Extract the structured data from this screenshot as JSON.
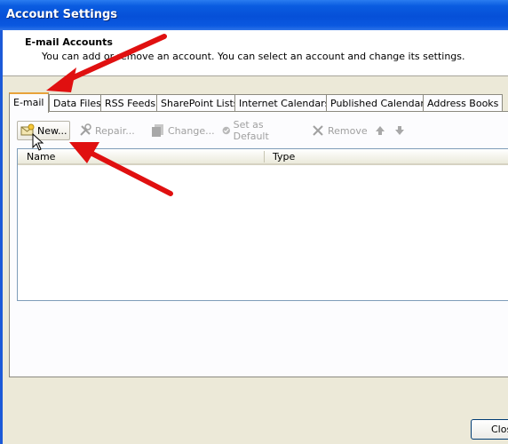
{
  "window": {
    "title": "Account Settings"
  },
  "header": {
    "title": "E-mail Accounts",
    "description": "You can add or remove an account. You can select an account and change its settings."
  },
  "tabs": [
    {
      "label": "E-mail",
      "active": true
    },
    {
      "label": "Data Files"
    },
    {
      "label": "RSS Feeds"
    },
    {
      "label": "SharePoint Lists"
    },
    {
      "label": "Internet Calendars"
    },
    {
      "label": "Published Calendars"
    },
    {
      "label": "Address Books"
    }
  ],
  "toolbar": {
    "new_label": "New...",
    "repair_label": "Repair...",
    "change_label": "Change...",
    "default_label": "Set as Default",
    "remove_label": "Remove"
  },
  "list": {
    "columns": [
      "Name",
      "Type"
    ]
  },
  "footer": {
    "close_label": "Close"
  },
  "colors": {
    "titlebar": "#0650d8",
    "annotation_arrow": "#e01010",
    "active_tab_accent": "#e8a33a"
  }
}
